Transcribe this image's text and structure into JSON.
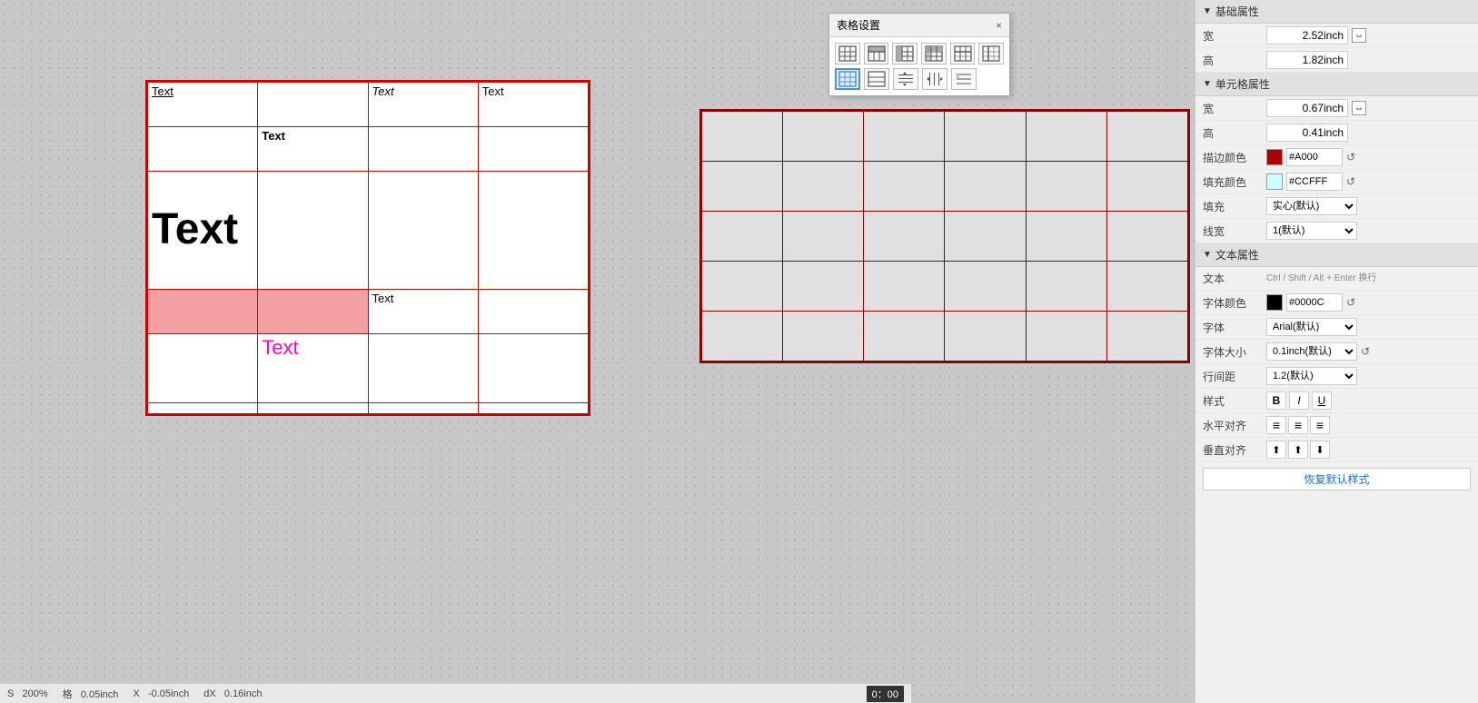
{
  "panel": {
    "basic_properties_label": "基础属性",
    "width_label": "宽",
    "width_value": "2.52inch",
    "height_label": "高",
    "height_value": "1.82inch",
    "cell_properties_label": "单元格属性",
    "cell_width_label": "宽",
    "cell_width_value": "0.67inch",
    "cell_height_label": "高",
    "cell_height_value": "0.41inch",
    "border_color_label": "描边颜色",
    "border_color_hex": "#A000",
    "border_color_full": "#A00000",
    "fill_color_label": "填充颜色",
    "fill_color_hex": "#CCFFF",
    "fill_color_full": "#CCFFFF",
    "fill_label": "填充",
    "fill_value": "实心(默认)",
    "line_width_label": "线宽",
    "line_width_value": "1(默认)",
    "text_properties_label": "文本属性",
    "text_label": "文本",
    "text_hint": "Ctrl / Shift / Alt + Enter 换行",
    "font_color_label": "字体颜色",
    "font_color_hex": "#0000C",
    "font_color_full": "#000000",
    "font_label": "字体",
    "font_value": "Arial(默认)",
    "font_size_label": "字体大小",
    "font_size_value": "0.1inch(默认)",
    "line_spacing_label": "行间距",
    "line_spacing_value": "1.2(默认)",
    "style_label": "样式",
    "bold_label": "B",
    "italic_label": "I",
    "underline_label": "U",
    "h_align_label": "水平对齐",
    "v_align_label": "垂直对齐",
    "restore_btn_label": "恢复默认样式"
  },
  "dialog": {
    "title": "表格设置",
    "close_label": "×"
  },
  "table_left": {
    "cells": [
      {
        "row": 0,
        "col": 0,
        "text": "Text",
        "style": "underline"
      },
      {
        "row": 0,
        "col": 1,
        "text": ""
      },
      {
        "row": 0,
        "col": 2,
        "text": "Text",
        "style": "italic"
      },
      {
        "row": 0,
        "col": 3,
        "text": "Text"
      },
      {
        "row": 1,
        "col": 0,
        "text": ""
      },
      {
        "row": 1,
        "col": 1,
        "text": "Text",
        "style": "bold"
      },
      {
        "row": 1,
        "col": 2,
        "text": ""
      },
      {
        "row": 1,
        "col": 3,
        "text": ""
      },
      {
        "row": 2,
        "col": 0,
        "text": "Text",
        "style": "large"
      },
      {
        "row": 2,
        "col": 1,
        "text": ""
      },
      {
        "row": 2,
        "col": 2,
        "text": ""
      },
      {
        "row": 2,
        "col": 3,
        "text": ""
      },
      {
        "row": 3,
        "col": 0,
        "text": "",
        "style": "pink"
      },
      {
        "row": 3,
        "col": 1,
        "text": "",
        "style": "pink"
      },
      {
        "row": 3,
        "col": 2,
        "text": "Text"
      },
      {
        "row": 3,
        "col": 3,
        "text": ""
      },
      {
        "row": 4,
        "col": 0,
        "text": ""
      },
      {
        "row": 4,
        "col": 1,
        "text": "Text",
        "style": "magenta"
      },
      {
        "row": 4,
        "col": 2,
        "text": ""
      },
      {
        "row": 4,
        "col": 3,
        "text": ""
      },
      {
        "row": 5,
        "col": 0,
        "text": ""
      },
      {
        "row": 5,
        "col": 1,
        "text": ""
      },
      {
        "row": 5,
        "col": 2,
        "text": ""
      },
      {
        "row": 5,
        "col": 3,
        "text": ""
      }
    ]
  },
  "status_bar": {
    "scale_label": "S",
    "scale_value": "200%",
    "grid_label": "格",
    "grid_value": "0.05inch",
    "x_label": "X",
    "x_value": "-0.05inch",
    "dx_label": "dX",
    "dx_value": "0.16inch",
    "time_value": "0：00"
  }
}
